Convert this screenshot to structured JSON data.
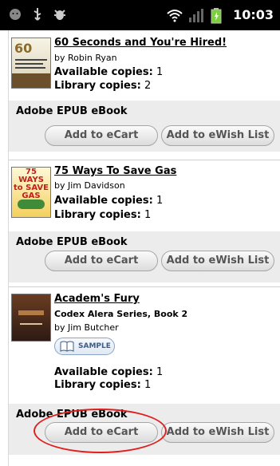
{
  "status_bar": {
    "time": "10:03",
    "icons": [
      "android-face-icon",
      "usb-icon",
      "debug-icon",
      "wifi-icon",
      "signal-icon",
      "battery-charging-icon"
    ]
  },
  "books": [
    {
      "title": "60 Seconds and You're Hired!",
      "author": "by Robin Ryan",
      "available_label": "Available copies:",
      "available_value": "1",
      "library_label": "Library copies:",
      "library_value": "2",
      "cover_text": "60",
      "format": "Adobe EPUB eBook",
      "cart_label": "Add to eCart",
      "wish_label": "Add to eWish List"
    },
    {
      "title": "75 Ways To Save Gas",
      "author": "by Jim Davidson",
      "available_label": "Available copies:",
      "available_value": "1",
      "library_label": "Library copies:",
      "library_value": "1",
      "cover_text": "75 WAYS to SAVE GAS",
      "format": "Adobe EPUB eBook",
      "cart_label": "Add to eCart",
      "wish_label": "Add to eWish List"
    },
    {
      "title": "Academ's Fury",
      "series": "Codex Alera Series, Book 2",
      "author": "by Jim Butcher",
      "sample_label": "SAMPLE",
      "available_label": "Available copies:",
      "available_value": "1",
      "library_label": "Library copies:",
      "library_value": "1",
      "format": "Adobe EPUB eBook",
      "cart_label": "Add to eCart",
      "wish_label": "Add to eWish List"
    }
  ],
  "colors": {
    "highlight": "#e01e1e",
    "panel": "#ececec",
    "status_bar": "#000000",
    "battery": "#7bd13a"
  }
}
